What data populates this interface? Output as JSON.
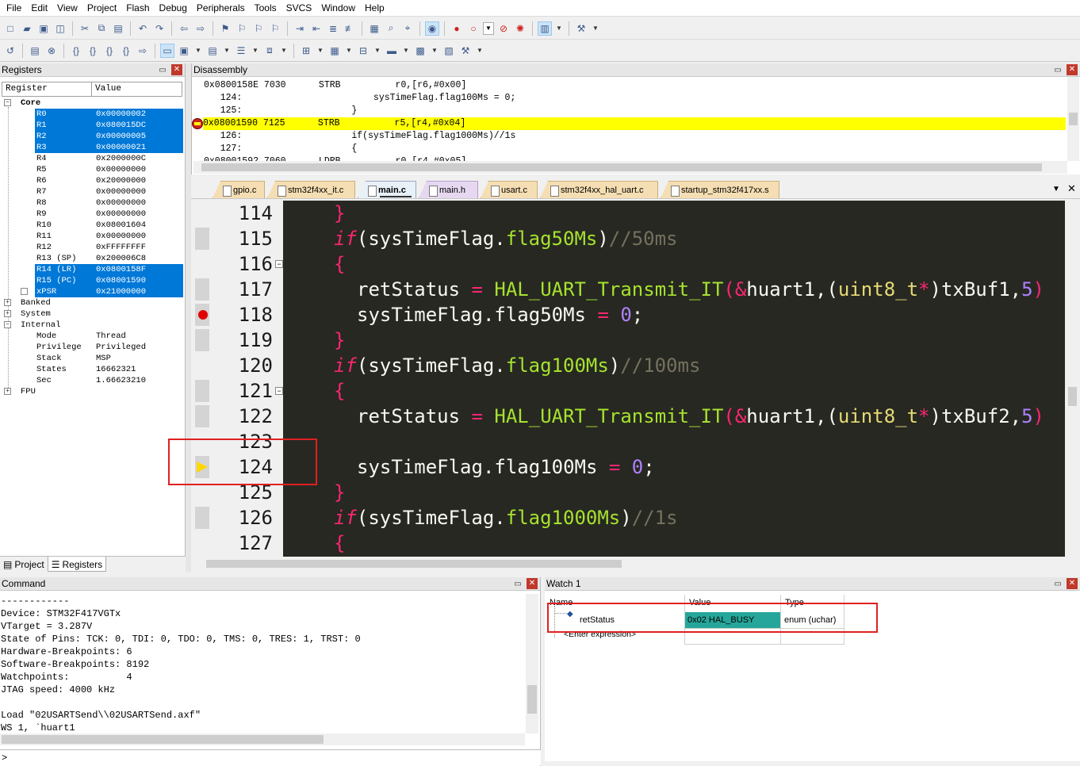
{
  "menu": [
    "File",
    "Edit",
    "View",
    "Project",
    "Flash",
    "Debug",
    "Peripherals",
    "Tools",
    "SVCS",
    "Window",
    "Help"
  ],
  "toolbar1_icons": [
    "new-file-icon",
    "open-folder-icon",
    "save-icon",
    "save-all-icon",
    "cut-icon",
    "copy-icon",
    "paste-icon",
    "undo-icon",
    "redo-icon",
    "nav-back-icon",
    "nav-forward-icon",
    "bookmark-icon",
    "bookmark-prev-icon",
    "bookmark-next-icon",
    "bookmark-clear-icon",
    "indent-icon",
    "unindent-icon",
    "comment-icon",
    "uncomment-icon",
    "find-in-files-icon",
    "find-icon",
    "incremental-find-icon",
    "debug-icon",
    "breakpoint-insert-icon",
    "breakpoint-enable-icon",
    "breakpoint-disable-icon",
    "breakpoint-kill-icon",
    "window-layout-icon",
    "configure-icon"
  ],
  "toolbar2_icons": [
    "reset-icon",
    "run-icon",
    "stop-icon",
    "step-into-icon",
    "step-over-icon",
    "step-out-icon",
    "run-to-cursor-icon",
    "show-next-statement-icon",
    "command-window-icon",
    "disassembly-window-icon",
    "symbols-window-icon",
    "registers-window-icon",
    "call-stack-icon",
    "watch-window-icon",
    "memory-window-icon",
    "serial-window-icon",
    "analysis-window-icon",
    "trace-window-icon",
    "system-viewer-icon",
    "toolbox-icon"
  ],
  "registers": {
    "title": "Registers",
    "col_register": "Register",
    "col_value": "Value",
    "rows": [
      {
        "name": "Core",
        "value": "",
        "level": 0,
        "expander": "−",
        "selected": false
      },
      {
        "name": "R0",
        "value": "0x00000002",
        "level": 2,
        "selected": true
      },
      {
        "name": "R1",
        "value": "0x080015DC",
        "level": 2,
        "selected": true
      },
      {
        "name": "R2",
        "value": "0x00000005",
        "level": 2,
        "selected": true
      },
      {
        "name": "R3",
        "value": "0x00000021",
        "level": 2,
        "selected": true
      },
      {
        "name": "R4",
        "value": "0x2000000C",
        "level": 2,
        "selected": false
      },
      {
        "name": "R5",
        "value": "0x00000000",
        "level": 2,
        "selected": false
      },
      {
        "name": "R6",
        "value": "0x20000000",
        "level": 2,
        "selected": false
      },
      {
        "name": "R7",
        "value": "0x00000000",
        "level": 2,
        "selected": false
      },
      {
        "name": "R8",
        "value": "0x00000000",
        "level": 2,
        "selected": false
      },
      {
        "name": "R9",
        "value": "0x00000000",
        "level": 2,
        "selected": false
      },
      {
        "name": "R10",
        "value": "0x08001604",
        "level": 2,
        "selected": false
      },
      {
        "name": "R11",
        "value": "0x00000000",
        "level": 2,
        "selected": false
      },
      {
        "name": "R12",
        "value": "0xFFFFFFFF",
        "level": 2,
        "selected": false
      },
      {
        "name": "R13 (SP)",
        "value": "0x200006C8",
        "level": 2,
        "selected": false
      },
      {
        "name": "R14 (LR)",
        "value": "0x0800158F",
        "level": 2,
        "selected": true
      },
      {
        "name": "R15 (PC)",
        "value": "0x08001590",
        "level": 2,
        "selected": true
      },
      {
        "name": "xPSR",
        "value": "0x21000000",
        "level": 2,
        "expander": "+",
        "selected": true
      },
      {
        "name": "Banked",
        "value": "",
        "level": 1,
        "expander": "+",
        "selected": false
      },
      {
        "name": "System",
        "value": "",
        "level": 1,
        "expander": "+",
        "selected": false
      },
      {
        "name": "Internal",
        "value": "",
        "level": 1,
        "expander": "−",
        "selected": false
      },
      {
        "name": "Mode",
        "value": "Thread",
        "level": 2,
        "selected": false
      },
      {
        "name": "Privilege",
        "value": "Privileged",
        "level": 2,
        "selected": false
      },
      {
        "name": "Stack",
        "value": "MSP",
        "level": 2,
        "selected": false
      },
      {
        "name": "States",
        "value": "16662321",
        "level": 2,
        "selected": false
      },
      {
        "name": "Sec",
        "value": "1.66623210",
        "level": 2,
        "selected": false
      },
      {
        "name": "FPU",
        "value": "",
        "level": 1,
        "expander": "+",
        "selected": false
      }
    ],
    "tabs": [
      "Project",
      "Registers"
    ]
  },
  "disassembly": {
    "title": "Disassembly",
    "lines": [
      {
        "text": "0x0800158E 7030      STRB          r0,[r6,#0x00]",
        "current": false
      },
      {
        "text": "   124:                        sysTimeFlag.flag100Ms = 0;",
        "current": false
      },
      {
        "text": "   125:                    }",
        "current": false
      },
      {
        "text": "0x08001590 7125      STRB          r5,[r4,#0x04]",
        "current": true
      },
      {
        "text": "   126:                    if(sysTimeFlag.flag1000Ms)//1s",
        "current": false
      },
      {
        "text": "   127:                    {",
        "current": false
      },
      {
        "text": "0x08001592 7060      LDRB          r0,[r4,#0x05]",
        "current": false
      }
    ]
  },
  "editor": {
    "tabs": [
      {
        "label": "gpio.c",
        "kind": "c",
        "active": false
      },
      {
        "label": "stm32f4xx_it.c",
        "kind": "c",
        "active": false
      },
      {
        "label": "main.c",
        "kind": "c",
        "active": true
      },
      {
        "label": "main.h",
        "kind": "h",
        "active": false
      },
      {
        "label": "usart.c",
        "kind": "c",
        "active": false
      },
      {
        "label": "stm32f4xx_hal_uart.c",
        "kind": "c",
        "active": false
      },
      {
        "label": "startup_stm32f417xx.s",
        "kind": "s",
        "active": false
      }
    ],
    "lines": [
      {
        "no": "114"
      },
      {
        "no": "115"
      },
      {
        "no": "116"
      },
      {
        "no": "117"
      },
      {
        "no": "118"
      },
      {
        "no": "119"
      },
      {
        "no": "120"
      },
      {
        "no": "121"
      },
      {
        "no": "122"
      },
      {
        "no": "123"
      },
      {
        "no": "124"
      },
      {
        "no": "125"
      },
      {
        "no": "126"
      },
      {
        "no": "127"
      }
    ],
    "code": {
      "l114_a": "}",
      "l115_kw": "if",
      "l115_a": "(sysTimeFlag.",
      "l115_b": "flag50Ms",
      "l115_c": ")",
      "l115_cm": "//50ms",
      "l116_a": "{",
      "l117_a": "retStatus ",
      "l117_eq": "=",
      "l117_fn": " HAL_UART_Transmit_IT",
      "l117_b": "(",
      "l117_amp": "&",
      "l117_c": "huart1,(",
      "l117_ty": "uint8_t",
      "l117_st": "*",
      "l117_d": ")txBuf1,",
      "l117_num": "5",
      "l117_e": ")",
      "l118_a": "sysTimeFlag.flag50Ms ",
      "l118_eq": "=",
      "l118_num": " 0",
      ";": ";",
      "l119_a": "}",
      "l120_kw": "if",
      "l120_a": "(sysTimeFlag.",
      "l120_b": "flag100Ms",
      "l120_c": ")",
      "l120_cm": "//100ms",
      "l121_a": "{",
      "l122_a": "retStatus ",
      "l122_eq": "=",
      "l122_fn": " HAL_UART_Transmit_IT",
      "l122_b": "(",
      "l122_amp": "&",
      "l122_c": "huart1,(",
      "l122_ty": "uint8_t",
      "l122_st": "*",
      "l122_d": ")txBuf2,",
      "l122_num": "5",
      "l122_e": ")",
      "l124_a": "sysTimeFlag.flag100Ms ",
      "l124_eq": "=",
      "l124_num": " 0",
      "l125_a": "}",
      "l126_kw": "if",
      "l126_a": "(sysTimeFlag.",
      "l126_b": "flag1000Ms",
      "l126_c": ")",
      "l126_cm": "//1s",
      "l127_a": "{"
    }
  },
  "command": {
    "title": "Command",
    "lines": [
      "------------",
      "Device: STM32F417VGTx",
      "VTarget = 3.287V",
      "State of Pins: TCK: 0, TDI: 0, TDO: 0, TMS: 0, TRES: 1, TRST: 0",
      "Hardware-Breakpoints: 6",
      "Software-Breakpoints: 8192",
      "Watchpoints:          4",
      "JTAG speed: 4000 kHz",
      "",
      "Load \"02USARTSend\\\\02USARTSend.axf\"",
      "WS 1, `huart1"
    ],
    "input_prompt": ">"
  },
  "watch": {
    "title": "Watch 1",
    "col_name": "Name",
    "col_value": "Value",
    "col_type": "Type",
    "row": {
      "name": "retStatus",
      "value": "0x02 HAL_BUSY",
      "type": "enum (uchar)"
    },
    "enter_expression": "<Enter expression>"
  },
  "colors": {
    "selection": "#0078d7",
    "current_line": "#ffff00",
    "watch_value_bg": "#26a69a",
    "annotation": "#e02020"
  }
}
